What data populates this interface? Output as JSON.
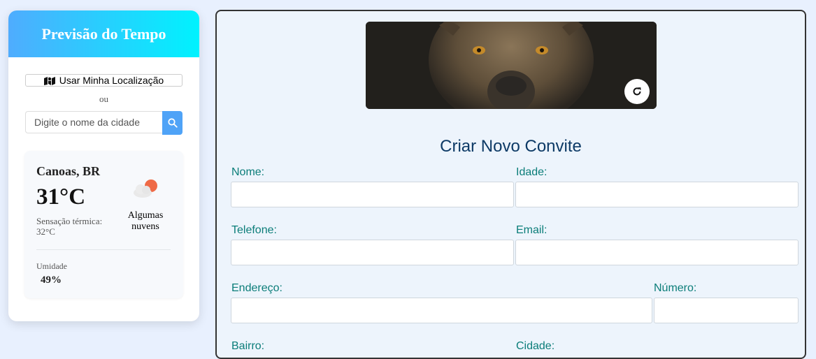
{
  "weather": {
    "title": "Previsão do Tempo",
    "location_button": "Usar Minha Localização",
    "or_text": "ou",
    "search_placeholder": "Digite o nome da cidade",
    "city": "Canoas, BR",
    "temperature": "31°C",
    "feels_like": "Sensação térmica: 32°C",
    "condition": "Algumas nuvens",
    "humidity_label": "Umidade",
    "humidity_value": "49%",
    "icons": {
      "location": "map-icon",
      "search": "search-icon",
      "condition": "partly-cloudy-icon"
    },
    "colors": {
      "header_start": "#4facfe",
      "header_end": "#00f2fe",
      "search_button": "#4fa3f7"
    }
  },
  "invite_form": {
    "title": "Criar Novo Convite",
    "banner_image": "lioness-photo",
    "refresh_icon": "refresh-icon",
    "fields": {
      "name": "Nome:",
      "age": "Idade:",
      "phone": "Telefone:",
      "email": "Email:",
      "address": "Endereço:",
      "number": "Número:",
      "neighborhood": "Bairro:",
      "city": "Cidade:"
    },
    "colors": {
      "label": "#0b7d79",
      "title": "#0d3a66",
      "panel_bg": "#edf4fc"
    }
  }
}
